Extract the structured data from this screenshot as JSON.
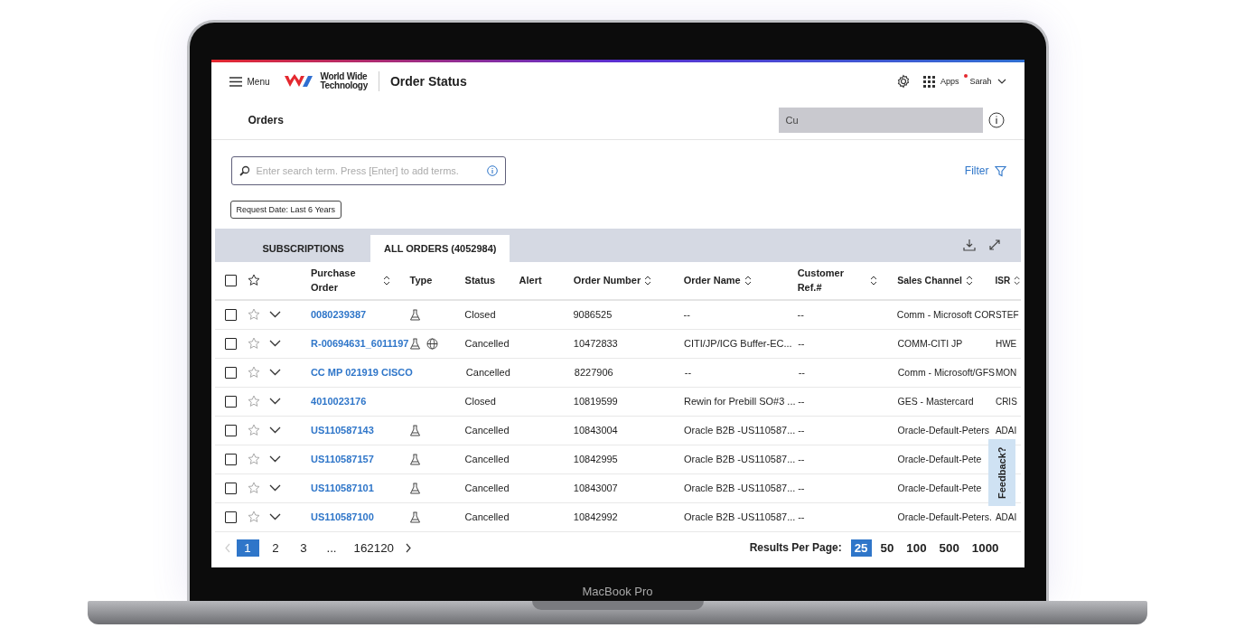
{
  "device": {
    "label": "MacBook Pro"
  },
  "header": {
    "menu_label": "Menu",
    "logo_line1": "World Wide",
    "logo_line2": "Technology",
    "app_title": "Order Status",
    "apps_label": "Apps",
    "user": "Sarah",
    "user_notification": true
  },
  "page": {
    "title": "Orders",
    "tooltip_text": "Cu"
  },
  "search": {
    "placeholder": "Enter search term. Press [Enter] to add terms."
  },
  "filter_label": "Filter",
  "chips": [
    "Request Date: Last 6 Years"
  ],
  "tabs": [
    {
      "label": "SUBSCRIPTIONS",
      "selected": false
    },
    {
      "label": "ALL ORDERS (4052984)",
      "selected": true
    }
  ],
  "table": {
    "select_all_checked": false,
    "columns": [
      {
        "label": "Purchase Order",
        "sortable": true
      },
      {
        "label": "Type",
        "sortable": false
      },
      {
        "label": "Status",
        "sortable": false
      },
      {
        "label": "Alert",
        "sortable": false
      },
      {
        "label": "Order Number",
        "sortable": true
      },
      {
        "label": "Order Name",
        "sortable": true
      },
      {
        "label": "Customer Ref.#",
        "sortable": true
      },
      {
        "label": "Sales Channel",
        "sortable": true
      },
      {
        "label": "ISR",
        "sortable": true
      }
    ],
    "rows": [
      {
        "checked": false,
        "starred": false,
        "po": "0080239387",
        "types": [
          {
            "kind": "flask"
          }
        ],
        "status": "Closed",
        "order_number": "9086525",
        "order_name": "--",
        "customer_ref": "--",
        "sales_channel": "Comm - Microsoft COR",
        "isr": "STEF"
      },
      {
        "checked": false,
        "starred": false,
        "po": "R-00694631_6011197",
        "types": [
          {
            "kind": "flask"
          },
          {
            "kind": "globe"
          }
        ],
        "status": "Cancelled",
        "order_number": "10472833",
        "order_name": "CITI/JP/ICG Buffer-EC...",
        "customer_ref": "--",
        "sales_channel": "COMM-CITI JP",
        "isr": "HWE"
      },
      {
        "checked": false,
        "starred": false,
        "po": "CC MP 021919 CISCO",
        "types": [],
        "status": "Cancelled",
        "order_number": "8227906",
        "order_name": "--",
        "customer_ref": "--",
        "sales_channel": "Comm - Microsoft/GFS",
        "isr": "MON"
      },
      {
        "checked": false,
        "starred": false,
        "po": "4010023176",
        "types": [],
        "status": "Closed",
        "order_number": "10819599",
        "order_name": "Rewin for Prebill SO#3 ...",
        "customer_ref": "--",
        "sales_channel": "GES - Mastercard",
        "isr": "CRIS"
      },
      {
        "checked": false,
        "starred": false,
        "po": "US110587143",
        "types": [
          {
            "kind": "flask"
          }
        ],
        "status": "Cancelled",
        "order_number": "10843004",
        "order_name": "Oracle B2B -US110587...",
        "customer_ref": "--",
        "sales_channel": "Oracle-Default-Peters",
        "isr": "ADAI"
      },
      {
        "checked": false,
        "starred": false,
        "po": "US110587157",
        "types": [
          {
            "kind": "flask"
          }
        ],
        "status": "Cancelled",
        "order_number": "10842995",
        "order_name": "Oracle B2B -US110587...",
        "customer_ref": "--",
        "sales_channel": "Oracle-Default-Pete"
      },
      {
        "checked": false,
        "starred": false,
        "po": "US110587101",
        "types": [
          {
            "kind": "flask"
          }
        ],
        "status": "Cancelled",
        "order_number": "10843007",
        "order_name": "Oracle B2B -US110587...",
        "customer_ref": "--",
        "sales_channel": "Oracle-Default-Pete"
      },
      {
        "checked": false,
        "starred": false,
        "po": "US110587100",
        "types": [
          {
            "kind": "flask"
          }
        ],
        "status": "Cancelled",
        "order_number": "10842992",
        "order_name": "Oracle B2B -US110587...",
        "customer_ref": "--",
        "sales_channel": "Oracle-Default-Peters.",
        "isr": "ADAI"
      }
    ]
  },
  "feedback_label": "Feedback?",
  "pagination": {
    "pages": [
      {
        "label": "1",
        "selected": true
      },
      {
        "label": "2",
        "selected": false
      },
      {
        "label": "3",
        "selected": false
      },
      {
        "label": "...",
        "selected": false
      },
      {
        "label": "162120",
        "selected": false
      }
    ],
    "per_page_label": "Results Per Page:",
    "per_page": [
      {
        "label": "25",
        "selected": true
      },
      {
        "label": "50",
        "selected": false
      },
      {
        "label": "100",
        "selected": false
      },
      {
        "label": "500",
        "selected": false
      },
      {
        "label": "1000",
        "selected": false
      }
    ]
  }
}
